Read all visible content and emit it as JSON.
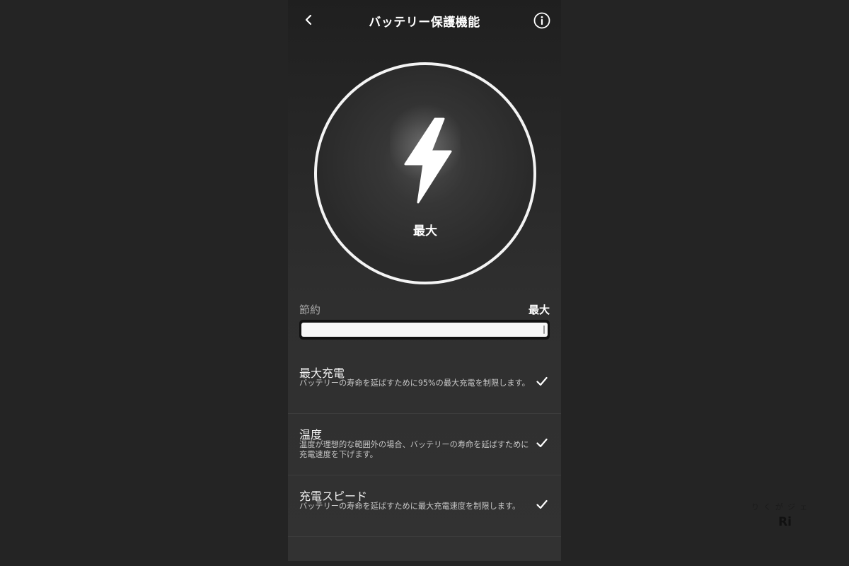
{
  "header": {
    "title": "バッテリー保護機能",
    "back_icon": "chevron-left-icon",
    "info_icon": "info-icon"
  },
  "mode_circle": {
    "icon": "lightning-bolt-icon",
    "label": "最大"
  },
  "slider": {
    "min_label": "節約",
    "max_label": "最大",
    "value_fraction": 1.0
  },
  "options": [
    {
      "title": "最大充電",
      "description": "バッテリーの寿命を延ばすために95%の最大充電を制限します。",
      "checked": true
    },
    {
      "title": "温度",
      "description": "温度が理想的な範囲外の場合、バッテリーの寿命を延ばすために充電速度を下げます。",
      "checked": true
    },
    {
      "title": "充電スピード",
      "description": "バッテリーの寿命を延ばすために最大充電速度を制限します。",
      "checked": true
    }
  ],
  "watermark": {
    "text": "りくがジェ",
    "logo": "Ri"
  },
  "colors": {
    "background": "#242424",
    "ring": "#f4f4f4",
    "slider_fill": "#f7f7f7",
    "text_secondary": "#c6c6c6"
  }
}
